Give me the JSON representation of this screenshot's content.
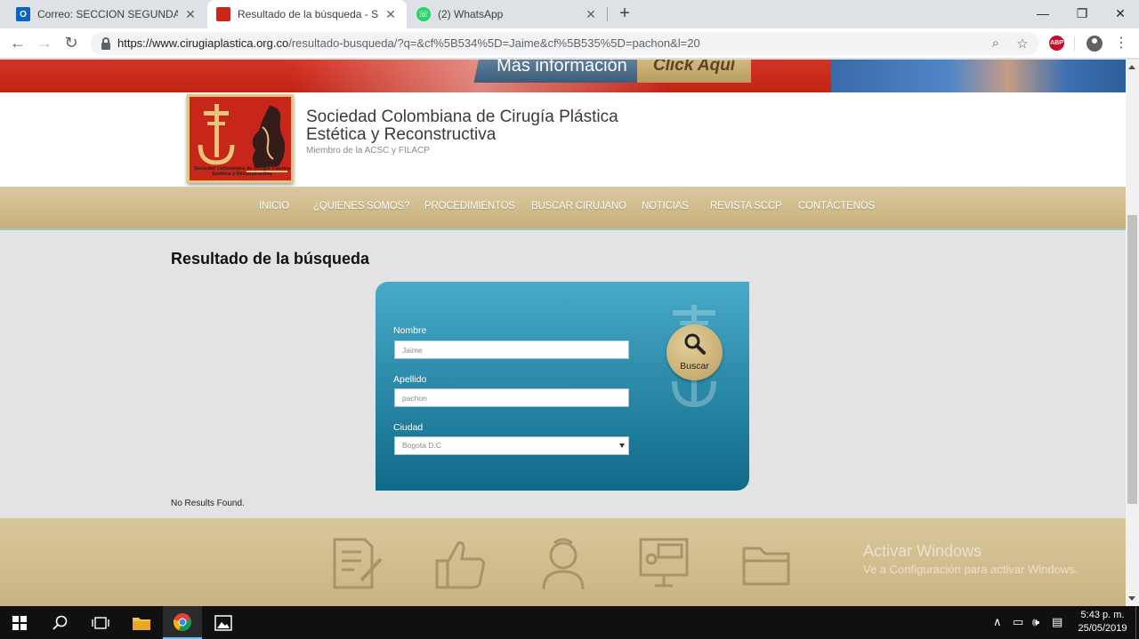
{
  "browser": {
    "tabs": [
      {
        "title": "Correo: SECCION SEGUNDA BATA",
        "active": false
      },
      {
        "title": "Resultado de la búsqueda - Soci",
        "active": true
      },
      {
        "title": "(2) WhatsApp",
        "active": false
      }
    ],
    "url_host": "https://www.cirugiaplastica.org.co",
    "url_path": "/resultado-busqueda/?q=&cf%5B534%5D=Jaime&cf%5B535%5D=pachon&l=20",
    "abp_label": "ABP"
  },
  "banner": {
    "more_info": "Más información",
    "click_here": "Click Aquí"
  },
  "header": {
    "org_name_line1": "Sociedad Colombiana de Cirugía Plástica",
    "org_name_line2": "Estética y Reconstructiva",
    "org_subtitle": "Miembro de la ACSC y FILACP",
    "logo_caption_line1": "Sociedad Colombiana de Cirugía Plástica",
    "logo_caption_line2": "Estética y Reconstructiva"
  },
  "nav": {
    "items": [
      "INICIO",
      "¿QUIENES SOMOS?",
      "PROCEDIMIENTOS",
      "BUSCAR CIRUJANO",
      "NOTICIAS",
      "REVISTA SCCP",
      "CONTÁCTENOS"
    ]
  },
  "page": {
    "title": "Resultado de la búsqueda",
    "no_results": "No Results Found."
  },
  "search_form": {
    "nombre_label": "Nombre",
    "nombre_value": "Jaime",
    "apellido_label": "Apellido",
    "apellido_value": "pachon",
    "ciudad_label": "Ciudad",
    "ciudad_value": "Bogota D.C",
    "buscar_label": "Buscar"
  },
  "windows_watermark": {
    "title": "Activar Windows",
    "subtitle": "Ve a Configuración para activar Windows."
  },
  "taskbar": {
    "time": "5:43 p. m.",
    "date": "25/05/2019"
  },
  "colors": {
    "nav_gold": "#c8b07a",
    "form_teal": "#0f6a88",
    "brand_red": "#c22315"
  }
}
